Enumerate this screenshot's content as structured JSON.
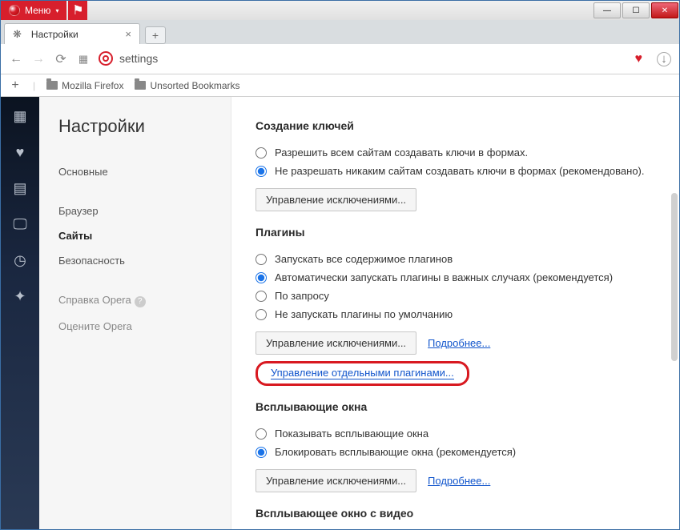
{
  "window": {
    "menu": "Меню"
  },
  "tab": {
    "title": "Настройки"
  },
  "address": {
    "value": "settings"
  },
  "bookmarks": {
    "folder1": "Mozilla Firefox",
    "folder2": "Unsorted Bookmarks"
  },
  "sidebar": {
    "title": "Настройки",
    "items": [
      "Основные",
      "Браузер",
      "Сайты",
      "Безопасность"
    ],
    "help": "Справка Opera",
    "rate": "Оцените Opera",
    "activeIndex": 2
  },
  "sections": {
    "keys": {
      "title": "Создание ключей",
      "opt_allow": "Разрешить всем сайтам создавать ключи в формах.",
      "opt_deny": "Не разрешать никаким сайтам создавать ключи в формах (рекомендовано).",
      "btn": "Управление исключениями..."
    },
    "plugins": {
      "title": "Плагины",
      "opt_run_all": "Запускать все содержимое плагинов",
      "opt_auto": "Автоматически запускать плагины в важных случаях (рекомендуется)",
      "opt_ondemand": "По запросу",
      "opt_never": "Не запускать плагины по умолчанию",
      "btn": "Управление исключениями...",
      "more": "Подробнее...",
      "manage_link": "Управление отдельными плагинами..."
    },
    "popups": {
      "title": "Всплывающие окна",
      "opt_show": "Показывать всплывающие окна",
      "opt_block": "Блокировать всплывающие окна (рекомендуется)",
      "btn": "Управление исключениями...",
      "more": "Подробнее..."
    },
    "video": {
      "title": "Всплывающее окно с видео"
    }
  }
}
